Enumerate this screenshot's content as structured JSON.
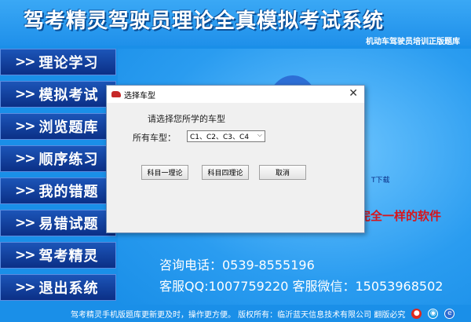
{
  "header": {
    "title": "驾考精灵驾驶员理论全真模拟考试系统",
    "subtitle": "机动车驾驶员培训正版题库"
  },
  "sidebar": {
    "arrow": ">>",
    "items": [
      {
        "label": "理论学习"
      },
      {
        "label": "模拟考试"
      },
      {
        "label": "浏览题库"
      },
      {
        "label": "顺序练习"
      },
      {
        "label": "我的错题"
      },
      {
        "label": "易错试题"
      },
      {
        "label": "驾考精灵"
      },
      {
        "label": "退出系统"
      }
    ]
  },
  "main": {
    "download_link": "T下载",
    "tagline": "完全一样的软件",
    "contact_phone": "咨询电话：0539-8555196",
    "contact_qq_wechat": "客服QQ:1007759220  客服微信：15053968502"
  },
  "footer": {
    "text": "驾考精灵手机版题库更新更及时，操作更方便。  版权所有：临沂蓝天信息技术有限公司 翻版必究"
  },
  "dialog": {
    "title": "选择车型",
    "prompt": "请选择您所学的车型",
    "field_label": "所有车型：",
    "select_value": "C1、C2、C3、C4",
    "buttons": {
      "subject1": "科目一理论",
      "subject4": "科目四理论",
      "cancel": "取消"
    }
  },
  "colors": {
    "background": "#1a8fe8",
    "nav_button": "#0b2f86",
    "tagline": "#d8141a"
  }
}
